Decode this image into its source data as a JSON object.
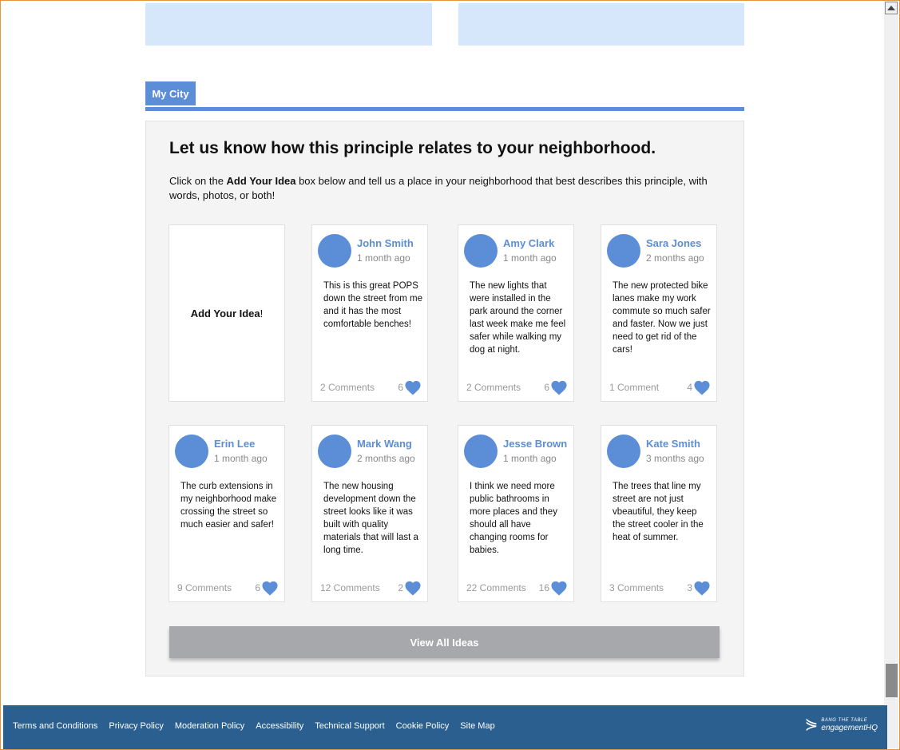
{
  "colors": {
    "accent": "#5b8ed6",
    "panel_bg": "#f4f4f4",
    "footer_bg": "#2a5f8f",
    "button_bg": "#a6a8ab",
    "top_box_bg": "#d6e6fb"
  },
  "tab": {
    "label": "My City"
  },
  "section": {
    "heading": "Let us know how this principle relates to your neighborhood.",
    "intro_before": "Click on the ",
    "intro_bold": "Add Your Idea",
    "intro_after": " box below and tell us a place in your neighborhood that best describes this principle, with words, photos, or both!"
  },
  "add_card": {
    "label_bold": "Add Your Idea",
    "label_suffix": "!"
  },
  "ideas": [
    {
      "name": "John Smith",
      "time": "1 month ago",
      "text": "This is this great POPS down the street from me and it has the most comfortable benches!",
      "comments": "2 Comments",
      "likes": "6"
    },
    {
      "name": "Amy Clark",
      "time": "1 month ago",
      "text": "The new lights that were installed in the park around the corner last week make me feel safer while walking my dog at night.",
      "comments": "2 Comments",
      "likes": "6"
    },
    {
      "name": "Sara Jones",
      "time": "2 months ago",
      "text": "The new protected bike lanes make my work commute so much safer and faster. Now we just need to get rid of the cars!",
      "comments": "1 Comment",
      "likes": "4"
    },
    {
      "name": "Erin Lee",
      "time": "1 month ago",
      "text": "The curb extensions in my neighborhood make crossing the street so much easier and safer!",
      "comments": "9 Comments",
      "likes": "6"
    },
    {
      "name": "Mark Wang",
      "time": "2 months ago",
      "text": "The new housing development down the street looks like it was built with quality materials that will last a long time.",
      "comments": "12 Comments",
      "likes": "2"
    },
    {
      "name": "Jesse Brown",
      "time": "1 month ago",
      "text": "I think we need more public bathrooms in more places and they should all have changing rooms for babies.",
      "comments": "22 Comments",
      "likes": "16"
    },
    {
      "name": "Kate Smith",
      "time": "3 months ago",
      "text": "The trees that line my street are not just vbeautiful, they keep the street cooler in the heat of summer.",
      "comments": "3 Comments",
      "likes": "3"
    }
  ],
  "view_all": {
    "label": "View All Ideas"
  },
  "footer": {
    "links": [
      "Terms and Conditions",
      "Privacy Policy",
      "Moderation Policy",
      "Accessibility",
      "Technical Support",
      "Cookie Policy",
      "Site Map"
    ],
    "logo_small": "BANG THE TABLE",
    "logo_big": "engagementHQ"
  }
}
